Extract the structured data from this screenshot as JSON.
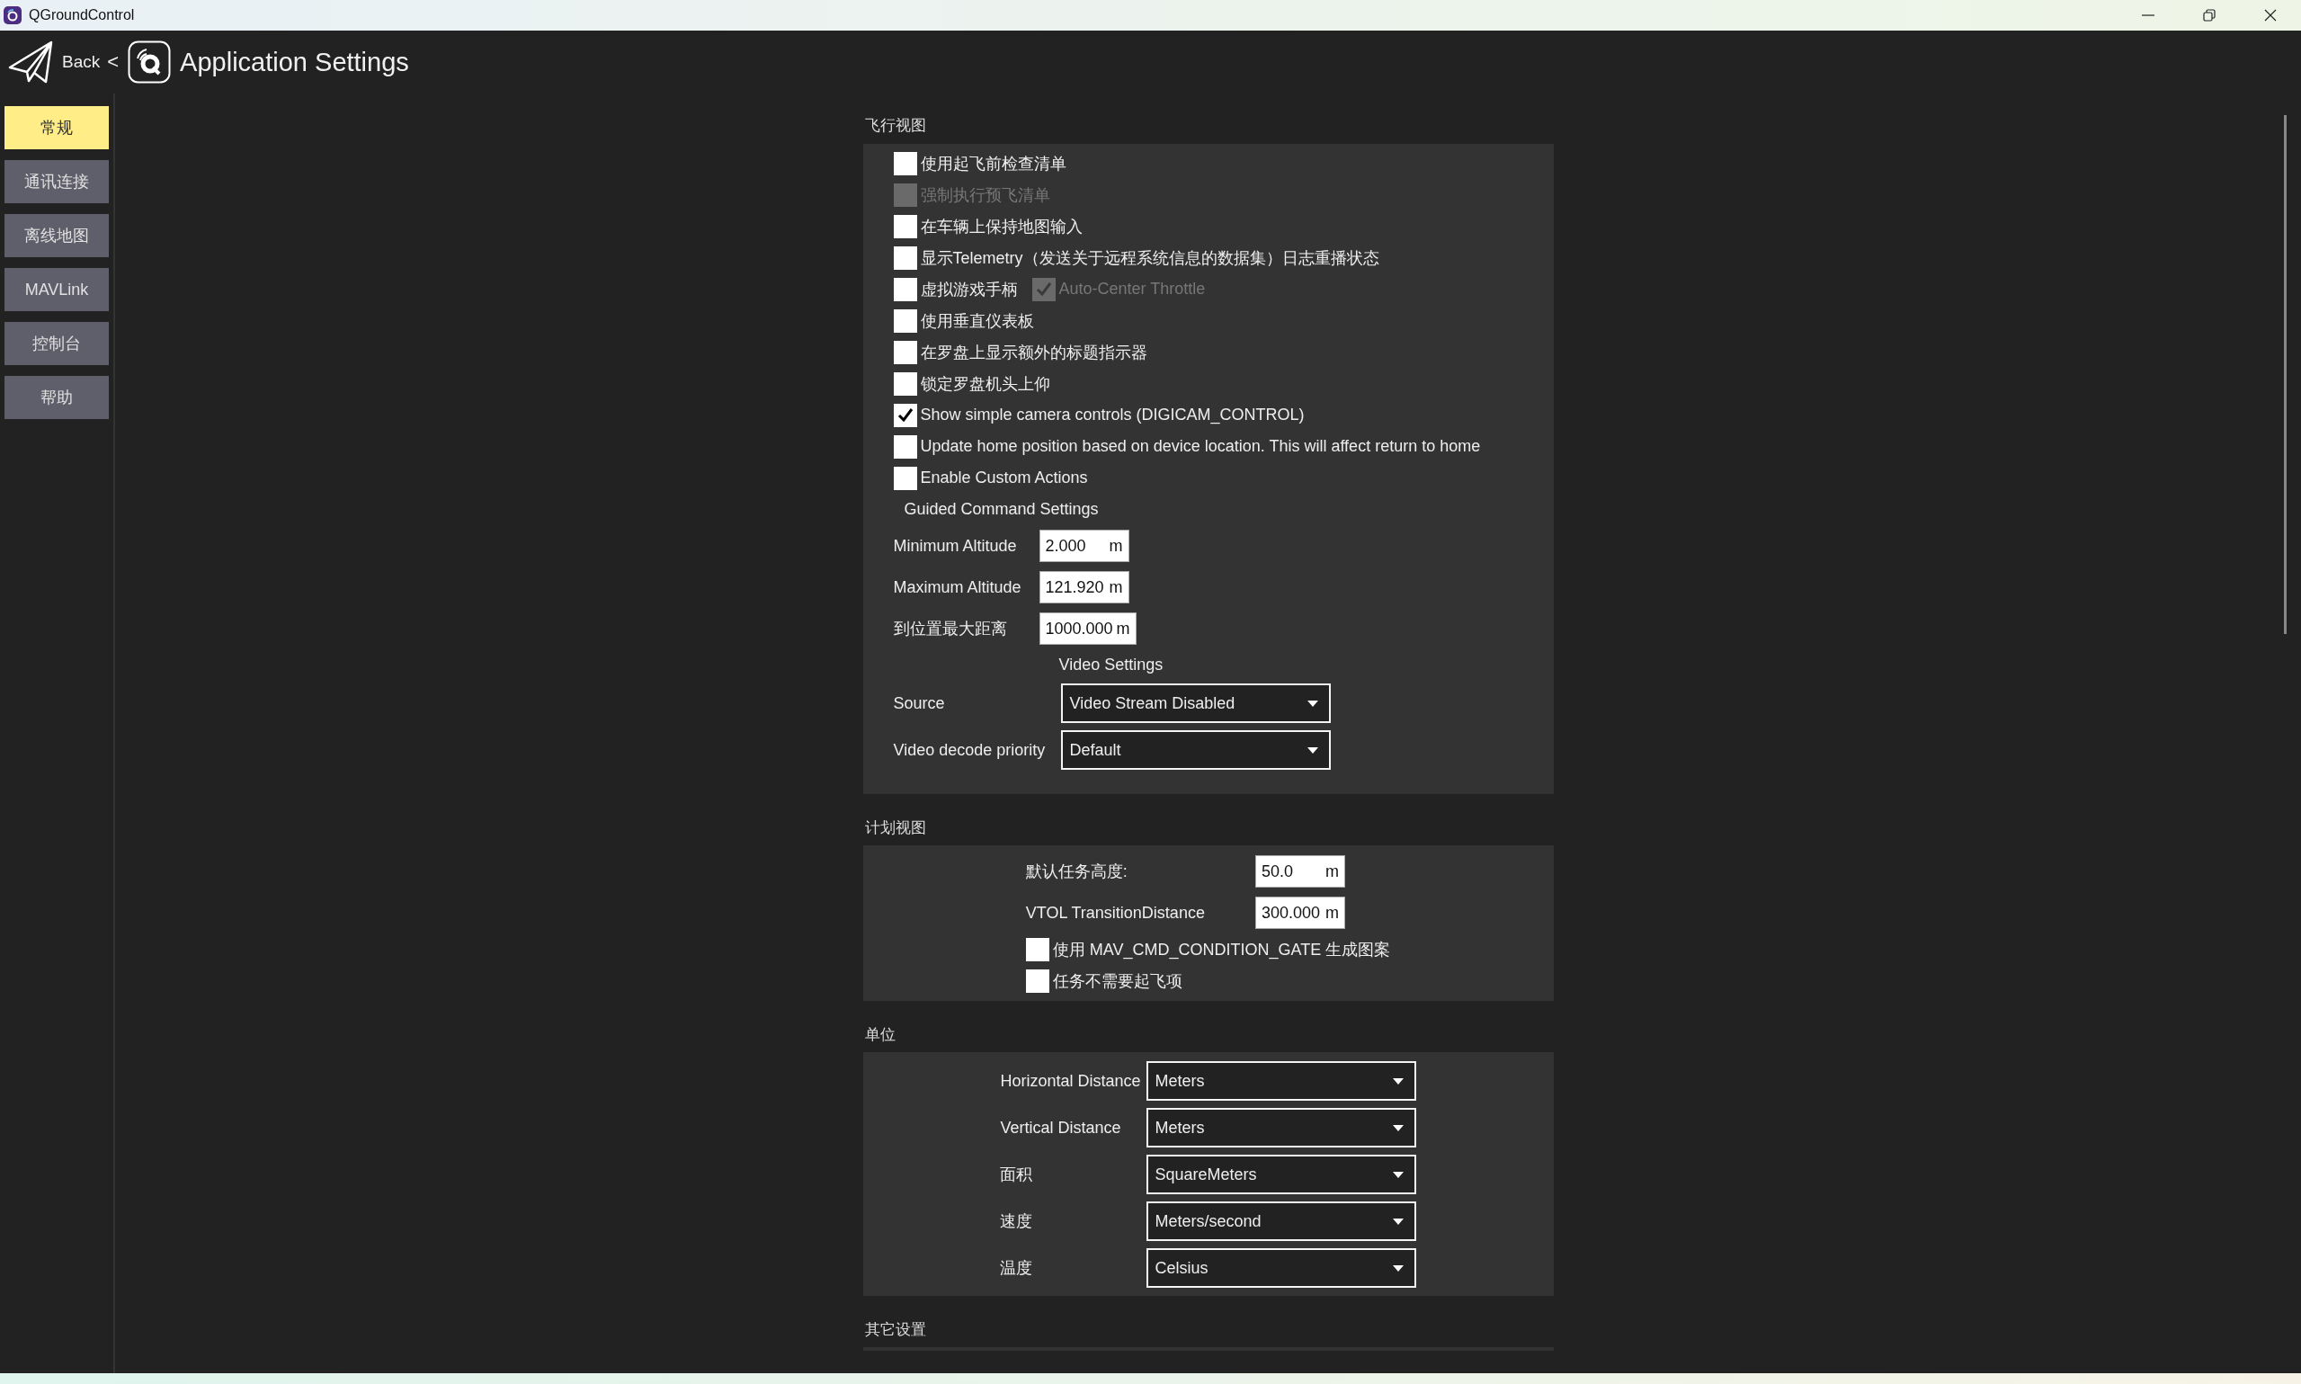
{
  "window": {
    "title": "QGroundControl"
  },
  "header": {
    "back": "Back",
    "separator": "<",
    "title": "Application Settings"
  },
  "sidebar": {
    "items": [
      {
        "label": "常规",
        "selected": true
      },
      {
        "label": "通讯连接",
        "selected": false
      },
      {
        "label": "离线地图",
        "selected": false
      },
      {
        "label": "MAVLink",
        "selected": false
      },
      {
        "label": "控制台",
        "selected": false
      },
      {
        "label": "帮助",
        "selected": false
      }
    ]
  },
  "sections": [
    {
      "title": "飞行视图",
      "rows": [
        {
          "kind": "checkbox",
          "label": "使用起飞前检查清单",
          "checked": false,
          "disabled": false
        },
        {
          "kind": "checkbox",
          "label": "强制执行预飞清单",
          "checked": false,
          "disabled": true
        },
        {
          "kind": "checkbox",
          "label": "在车辆上保持地图输入",
          "checked": false,
          "disabled": false
        },
        {
          "kind": "checkbox",
          "label": "显示Telemetry（发送关于远程系统信息的数据集）日志重播状态",
          "checked": false,
          "disabled": false
        },
        {
          "kind": "checkbox",
          "label": "虚拟游戏手柄",
          "checked": false,
          "disabled": false,
          "extra": {
            "label": "Auto-Center Throttle",
            "checked": true,
            "disabled": true
          }
        },
        {
          "kind": "checkbox",
          "label": "使用垂直仪表板",
          "checked": false,
          "disabled": false
        },
        {
          "kind": "checkbox",
          "label": "在罗盘上显示额外的标题指示器",
          "checked": false,
          "disabled": false
        },
        {
          "kind": "checkbox",
          "label": "锁定罗盘机头上仰",
          "checked": false,
          "disabled": false
        },
        {
          "kind": "checkbox",
          "label": "Show simple camera controls (DIGICAM_CONTROL)",
          "checked": true,
          "disabled": false
        },
        {
          "kind": "checkbox",
          "label": "Update home position based on device location. This will affect return to home",
          "checked": false,
          "disabled": false
        },
        {
          "kind": "checkbox",
          "label": "Enable Custom Actions",
          "checked": false,
          "disabled": false
        },
        {
          "kind": "heading",
          "label": "Guided Command Settings"
        },
        {
          "kind": "field",
          "label": "Minimum Altitude",
          "value": "2.000",
          "unit": "m"
        },
        {
          "kind": "field",
          "label": "Maximum Altitude",
          "value": "121.920",
          "unit": "m"
        },
        {
          "kind": "field",
          "label": "到位置最大距离",
          "value": "1000.000",
          "unit": "m"
        },
        {
          "kind": "column_heading",
          "label": "Video Settings"
        },
        {
          "kind": "combo",
          "label": "Source",
          "value": "Video Stream Disabled"
        },
        {
          "kind": "combo",
          "label": "Video decode priority",
          "value": "Default"
        }
      ]
    },
    {
      "title": "计划视图",
      "rows": [
        {
          "kind": "field",
          "label": "默认任务高度:",
          "value": "50.0",
          "unit": "m"
        },
        {
          "kind": "field",
          "label": "VTOL TransitionDistance",
          "value": "300.000",
          "unit": "m"
        },
        {
          "kind": "checkbox",
          "label": "使用 MAV_CMD_CONDITION_GATE 生成图案",
          "checked": false,
          "disabled": false
        },
        {
          "kind": "checkbox",
          "label": "任务不需要起飞项",
          "checked": false,
          "disabled": false
        }
      ]
    },
    {
      "title": "单位",
      "rows": [
        {
          "kind": "combo",
          "label": "Horizontal Distance",
          "value": "Meters"
        },
        {
          "kind": "combo",
          "label": "Vertical Distance",
          "value": "Meters"
        },
        {
          "kind": "combo",
          "label": "面积",
          "value": "SquareMeters"
        },
        {
          "kind": "combo",
          "label": "速度",
          "value": "Meters/second"
        },
        {
          "kind": "combo",
          "label": "温度",
          "value": "Celsius"
        }
      ]
    },
    {
      "title": "其它设置"
    }
  ]
}
